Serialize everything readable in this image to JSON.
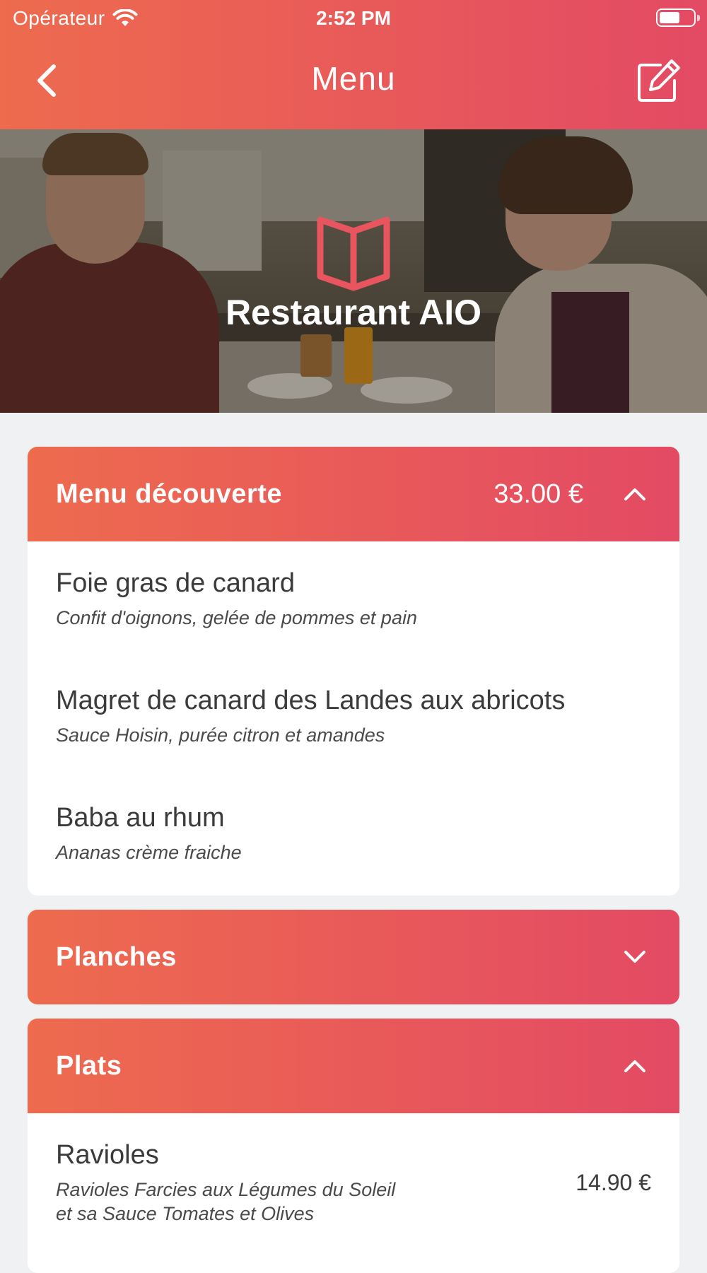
{
  "status_bar": {
    "carrier": "Opérateur",
    "time": "2:52 PM"
  },
  "navbar": {
    "title": "Menu"
  },
  "hero": {
    "restaurant_name": "Restaurant AIO"
  },
  "sections": [
    {
      "title": "Menu découverte",
      "price": "33.00 €",
      "expanded": true,
      "items": [
        {
          "name": "Foie gras de canard",
          "description": "Confit d'oignons, gelée de pommes et pain"
        },
        {
          "name": "Magret de canard des Landes aux abricots",
          "description": "Sauce Hoisin, purée citron et amandes"
        },
        {
          "name": "Baba au rhum",
          "description": "Ananas crème fraiche"
        }
      ]
    },
    {
      "title": "Planches",
      "expanded": false
    },
    {
      "title": "Plats",
      "expanded": true,
      "items": [
        {
          "name": "Ravioles",
          "description_lines": [
            "Ravioles Farcies aux Légumes du Soleil",
            "et sa Sauce Tomates et Olives"
          ],
          "price": "14.90 €"
        }
      ]
    }
  ],
  "colors": {
    "gradient_start": "#ee6b4e",
    "gradient_end": "#e34a64",
    "background": "#f0f1f3"
  },
  "icons": {
    "back": "chevron-left-icon",
    "edit": "edit-square-icon",
    "logo": "open-book-icon",
    "expand": "chevron-down-icon",
    "collapse": "chevron-up-icon"
  }
}
